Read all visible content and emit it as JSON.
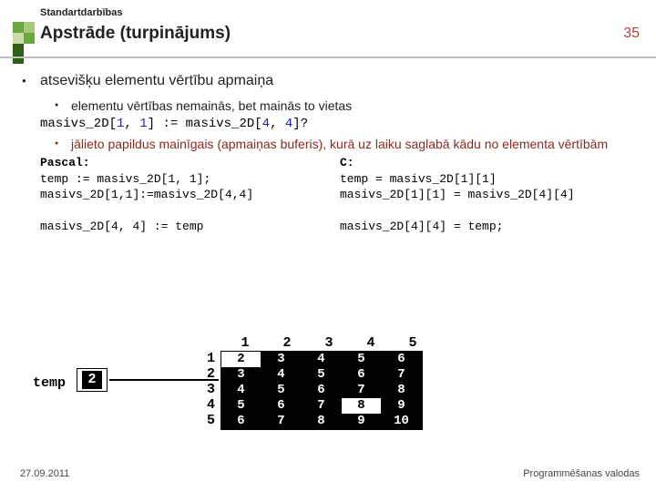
{
  "header": {
    "pretitle": "Standartdarbības",
    "title": "Apstrāde (turpinājums)",
    "page": "35"
  },
  "bullets": {
    "b1": "atsevišķu elementu vērtību apmaiņa",
    "b2a": "elementu vērtības nemainās, bet mainās to vietas",
    "b2b": "jālieto papildus mainīgais (apmaiņas buferis), kurā uz laiku saglabā kādu no elementa vērtībām"
  },
  "code_top": {
    "plain1": "masivs_2D[",
    "i1a": "1",
    "sep1": ", ",
    "i1b": "1",
    "plain2": "] := masivs_2D[",
    "i2a": "4",
    "sep2": ", ",
    "i2b": "4",
    "plain3": "]?"
  },
  "pascal": {
    "title": "Pascal:",
    "l1a": "temp := masivs_2D[",
    "l1b": "1",
    "l1c": ", ",
    "l1d": "1",
    "l1e": "];",
    "l2a": "masivs_2D[",
    "l2b": "1",
    "l2c": ",",
    "l2d": "1",
    "l2e": "]:=masivs_2D[",
    "l2f": "4",
    "l2g": ",",
    "l2h": "4",
    "l2i": "]",
    "l3a": "masivs_2D[",
    "l3b": "4",
    "l3c": ", ",
    "l3d": "4",
    "l3e": "] := temp"
  },
  "c": {
    "title": "C:",
    "l1a": "temp = masivs_2D[",
    "l1b": "1",
    "l1c": "][",
    "l1d": "1",
    "l1e": "]",
    "l2a": "masivs_2D[",
    "l2b": "1",
    "l2c": "][",
    "l2d": "1",
    "l2e": "] = masivs_2D[",
    "l2f": "4",
    "l2g": "][",
    "l2h": "4",
    "l2i": "]",
    "l3a": "masivs_2D[",
    "l3b": "4",
    "l3c": "][",
    "l3d": "4",
    "l3e": "] = temp;"
  },
  "figure": {
    "temp_label": "temp",
    "temp_value": "2",
    "col_headers": [
      "1",
      "2",
      "3",
      "4",
      "5"
    ],
    "row_headers": [
      "1",
      "2",
      "3",
      "4",
      "5"
    ],
    "matrix": [
      [
        "2",
        "3",
        "4",
        "5",
        "6"
      ],
      [
        "3",
        "4",
        "5",
        "6",
        "7"
      ],
      [
        "4",
        "5",
        "6",
        "7",
        "8"
      ],
      [
        "5",
        "6",
        "7",
        "8",
        "9"
      ],
      [
        "6",
        "7",
        "8",
        "9",
        "10"
      ]
    ]
  },
  "footer": {
    "date": "27.09.2011",
    "source": "Programmēšanas valodas"
  }
}
